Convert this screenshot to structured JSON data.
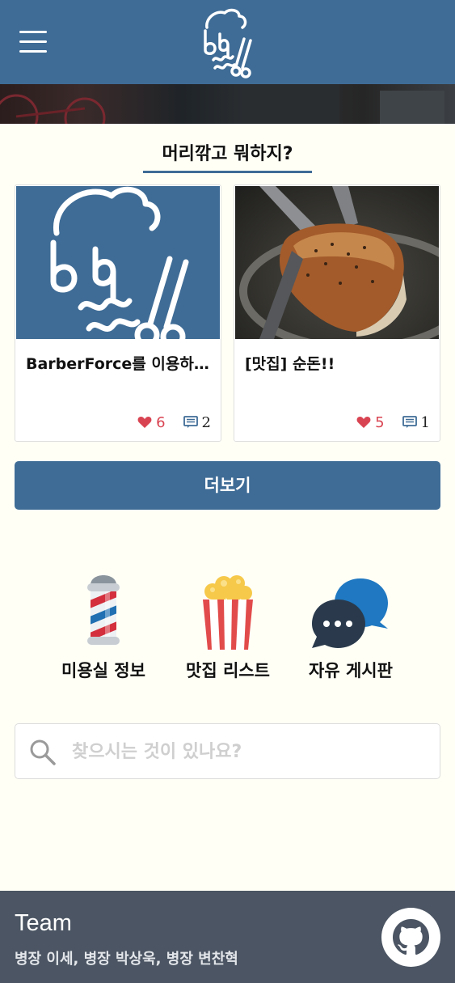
{
  "header": {
    "menu_icon": "hamburger-icon",
    "logo_icon": "barberforce-logo-icon"
  },
  "section": {
    "title": "머리깎고 뭐하지?"
  },
  "cards": [
    {
      "title": "BarberForce를 이용하여 ...",
      "likes": "6",
      "comments": "2",
      "image": "barberforce-logo-image"
    },
    {
      "title": "[맛집] 순돈!!",
      "likes": "5",
      "comments": "1",
      "image": "grilled-pork-photo"
    }
  ],
  "more_button": {
    "label": "더보기"
  },
  "categories": [
    {
      "label": "미용실 정보",
      "icon": "barber-pole-icon"
    },
    {
      "label": "맛집 리스트",
      "icon": "popcorn-icon"
    },
    {
      "label": "자유 게시판",
      "icon": "chat-bubbles-icon"
    }
  ],
  "search": {
    "placeholder": "찾으시는 것이 있나요?",
    "value": ""
  },
  "footer": {
    "title": "Team",
    "members": "병장 이세, 병장 박상욱, 병장 변찬혁",
    "github_icon": "github-icon"
  },
  "colors": {
    "primary": "#3f6c96",
    "background": "#fffff6",
    "footer": "#4b5563",
    "like": "#d94452"
  }
}
